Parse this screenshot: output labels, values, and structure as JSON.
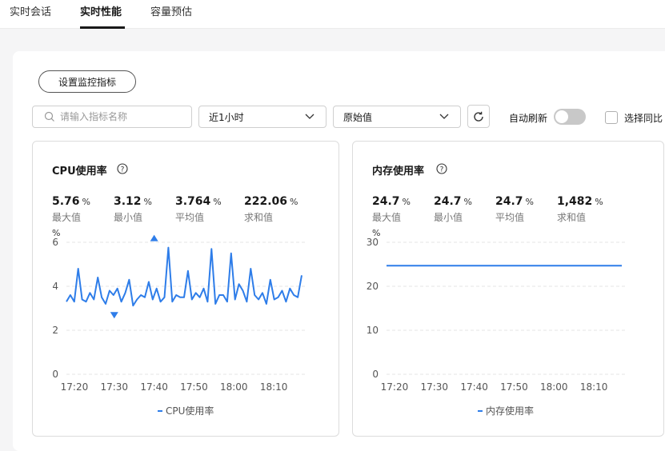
{
  "tabs": [
    {
      "label": "实时会话",
      "active": false
    },
    {
      "label": "实时性能",
      "active": true
    },
    {
      "label": "容量预估",
      "active": false
    }
  ],
  "toolbar": {
    "settings_label": "设置监控指标",
    "search_placeholder": "请输入指标名称",
    "time_range": "近1小时",
    "value_mode": "原始值",
    "auto_refresh_label": "自动刷新",
    "auto_refresh_on": false,
    "compare_label": "选择同比",
    "compare_checked": false
  },
  "colors": {
    "accent": "#1a73e8",
    "line": "#2e7de9"
  },
  "cpu": {
    "title": "CPU使用率",
    "help_icon": "question-circle-icon",
    "stats": [
      {
        "value": "5.76",
        "unit": "%",
        "label": "最大值"
      },
      {
        "value": "3.12",
        "unit": "%",
        "label": "最小值"
      },
      {
        "value": "3.764",
        "unit": "%",
        "label": "平均值"
      },
      {
        "value": "222.06",
        "unit": "%",
        "label": "求和值"
      }
    ]
  },
  "memory": {
    "title": "内存使用率",
    "help_icon": "question-circle-icon",
    "stats": [
      {
        "value": "24.7",
        "unit": "%",
        "label": "最大值"
      },
      {
        "value": "24.7",
        "unit": "%",
        "label": "最小值"
      },
      {
        "value": "24.7",
        "unit": "%",
        "label": "平均值"
      },
      {
        "value": "1,482",
        "unit": "%",
        "label": "求和值"
      }
    ]
  },
  "chart_data": [
    {
      "type": "line",
      "title": "CPU使用率",
      "ylabel": "%",
      "ylim": [
        0,
        6
      ],
      "yticks": [
        0,
        2,
        4,
        6
      ],
      "x_range": [
        "17:18",
        "18:17"
      ],
      "x_ticks": [
        "17:20",
        "17:30",
        "17:40",
        "17:50",
        "18:00",
        "18:10"
      ],
      "grid": true,
      "legend_position": "bottom",
      "markers": {
        "max": {
          "x": "17:40",
          "y": 5.76
        },
        "min": {
          "x": "17:30",
          "y": 3.12
        }
      },
      "series": [
        {
          "name": "CPU使用率",
          "values": [
            3.3,
            3.6,
            3.3,
            4.8,
            3.4,
            3.3,
            3.7,
            3.4,
            4.4,
            3.5,
            3.2,
            3.8,
            3.6,
            3.9,
            3.3,
            3.7,
            4.3,
            3.12,
            3.4,
            3.6,
            3.5,
            4.2,
            3.4,
            3.9,
            3.3,
            3.5,
            5.76,
            3.3,
            3.6,
            3.5,
            3.5,
            4.7,
            3.4,
            3.7,
            3.5,
            3.9,
            3.3,
            5.7,
            3.2,
            3.6,
            3.6,
            3.3,
            5.5,
            3.4,
            4.1,
            3.8,
            3.3,
            4.8,
            3.6,
            3.4,
            3.7,
            3.2,
            4.3,
            3.4,
            3.5,
            3.8,
            3.3,
            3.9,
            3.6,
            3.5,
            4.5
          ]
        }
      ]
    },
    {
      "type": "line",
      "title": "内存使用率",
      "ylabel": "%",
      "ylim": [
        0,
        30
      ],
      "yticks": [
        0,
        10,
        20,
        30
      ],
      "x_range": [
        "17:18",
        "18:17"
      ],
      "x_ticks": [
        "17:20",
        "17:30",
        "17:40",
        "17:50",
        "18:00",
        "18:10"
      ],
      "grid": true,
      "legend_position": "bottom",
      "series": [
        {
          "name": "内存使用率",
          "values": [
            24.7,
            24.7
          ]
        }
      ]
    }
  ]
}
